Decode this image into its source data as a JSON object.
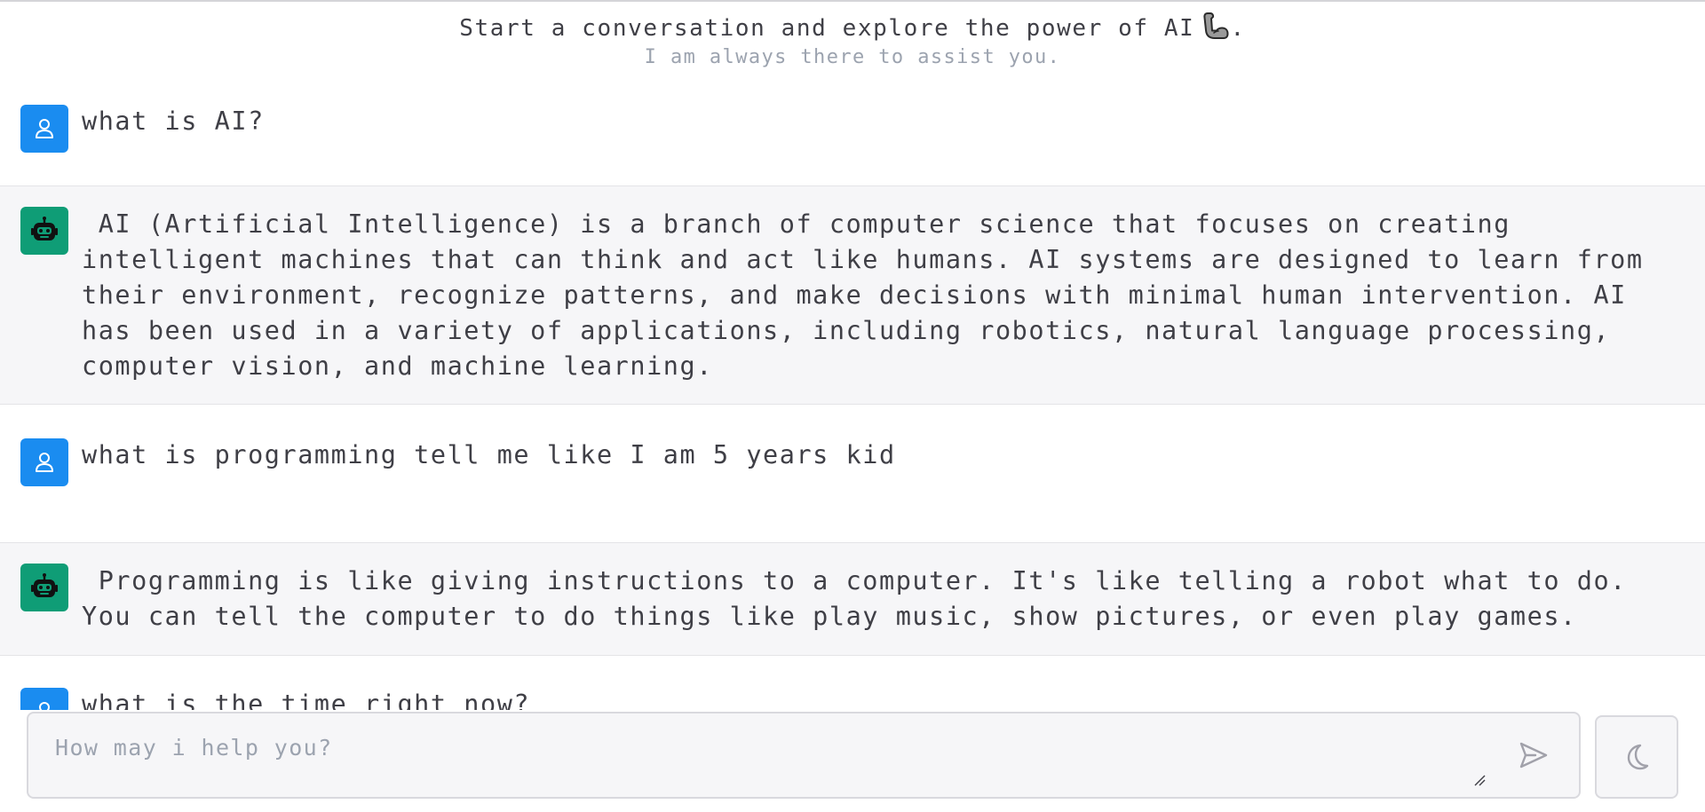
{
  "header": {
    "title": "Start a conversation and explore the power of AI",
    "title_suffix": ".",
    "title_icon": "flexed-biceps-icon",
    "subtitle": "I am always there to assist you."
  },
  "messages": [
    {
      "role": "user",
      "avatar_icon": "user-icon",
      "text": "what is AI?"
    },
    {
      "role": "assistant",
      "avatar_icon": "robot-icon",
      "text": " AI (Artificial Intelligence) is a branch of computer science that focuses on creating intelligent machines that can think and act like humans. AI systems are designed to learn from their environment, recognize patterns, and make decisions with minimal human intervention. AI has been used in a variety of applications, including robotics, natural language processing, computer vision, and machine learning."
    },
    {
      "role": "user",
      "avatar_icon": "user-icon",
      "text": "what is programming tell me like I am 5 years kid"
    },
    {
      "role": "assistant",
      "avatar_icon": "robot-icon",
      "text": " Programming is like giving instructions to a computer. It's like telling a robot what to do. You can tell the computer to do things like play music, show pictures, or even play games."
    },
    {
      "role": "user",
      "avatar_icon": "user-icon",
      "text": "what is the time right now?"
    }
  ],
  "composer": {
    "placeholder": "How may i help you?",
    "value": "",
    "send_icon": "send-icon",
    "theme_toggle_icon": "moon-icon"
  },
  "colors": {
    "user_avatar": "#1a8cf0",
    "bot_avatar": "#0f9d76",
    "bot_row_bg": "#f6f6f8",
    "text": "#3f3f46",
    "muted_text": "#9ca3af"
  }
}
